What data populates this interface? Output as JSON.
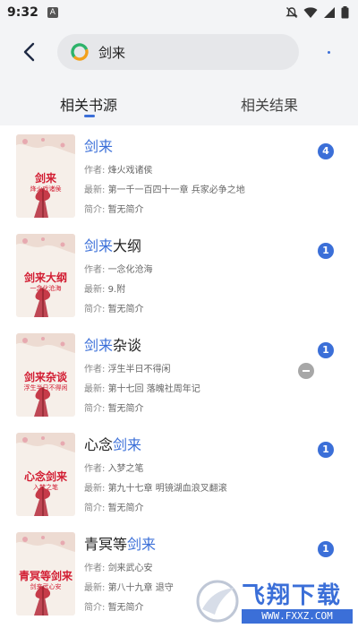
{
  "status_bar": {
    "time": "9:32",
    "notification_icon": "A"
  },
  "header": {
    "search_value": "剑来"
  },
  "tabs": [
    {
      "label": "相关书源",
      "active": true
    },
    {
      "label": "相关结果",
      "active": false
    }
  ],
  "labels": {
    "author": "作者:",
    "latest": "最新:",
    "intro": "简介:"
  },
  "books": [
    {
      "title_parts": [
        {
          "text": "剑来",
          "hl": true
        }
      ],
      "author": "烽火戏诸侯",
      "latest": "第一千一百四十一章 兵家必争之地",
      "intro": "暂无简介",
      "count": "4",
      "cover_title": "剑来",
      "cover_author": "烽火戏诸侯"
    },
    {
      "title_parts": [
        {
          "text": "剑来",
          "hl": true
        },
        {
          "text": "大纲",
          "hl": false
        }
      ],
      "author": "一念化沧海",
      "latest": "9.附",
      "intro": "暂无简介",
      "count": "1",
      "cover_title": "剑来大纲",
      "cover_author": "一念化沧海"
    },
    {
      "title_parts": [
        {
          "text": "剑来",
          "hl": true
        },
        {
          "text": "杂谈",
          "hl": false
        }
      ],
      "author": "浮生半日不得闲",
      "latest": "第十七回 落魄社周年记",
      "intro": "暂无简介",
      "count": "1",
      "cover_title": "剑来杂谈",
      "cover_author": "浮生半日不得闲"
    },
    {
      "title_parts": [
        {
          "text": "心念",
          "hl": false
        },
        {
          "text": "剑来",
          "hl": true
        }
      ],
      "author": "入梦之笔",
      "latest": "第九十七章 明镜湖血浪叉翻滚",
      "intro": "暂无简介",
      "count": "1",
      "cover_title": "心念剑来",
      "cover_author": "入梦之笔"
    },
    {
      "title_parts": [
        {
          "text": "青冥等",
          "hl": false
        },
        {
          "text": "剑来",
          "hl": true
        }
      ],
      "author": "剑来武心安",
      "latest": "第八十九章 退守",
      "intro": "暂无简介",
      "count": "1",
      "cover_title": "青冥等剑来",
      "cover_author": "剑来武心安"
    }
  ],
  "watermark": {
    "title": "飞翔下载",
    "url": "WWW.FXXZ.COM"
  },
  "colors": {
    "accent": "#3b6fd8",
    "cover_red": "#d21d32",
    "header_bg": "#f3f4f6"
  }
}
